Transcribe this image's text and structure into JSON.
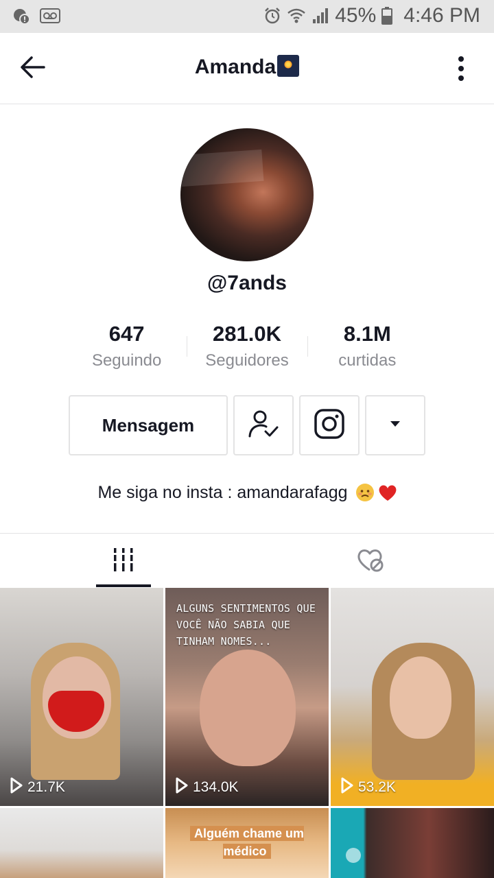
{
  "status_bar": {
    "battery": "45%",
    "time": "4:46 PM",
    "icons": [
      "notification-icon",
      "voicemail-icon",
      "alarm-icon",
      "wifi-icon",
      "signal-icon",
      "battery-icon"
    ]
  },
  "header": {
    "title": "Amanda",
    "title_emoji": "night-sky-emoji",
    "back_icon": "back-arrow-icon",
    "more_icon": "more-vertical-icon"
  },
  "profile": {
    "handle": "@7ands",
    "stats": [
      {
        "value": "647",
        "label": "Seguindo"
      },
      {
        "value": "281.0K",
        "label": "Seguidores"
      },
      {
        "value": "8.1M",
        "label": "curtidas"
      }
    ],
    "actions": {
      "message_label": "Mensagem",
      "follow_icon": "user-check-icon",
      "instagram_icon": "instagram-icon",
      "dropdown_icon": "caret-down-icon"
    },
    "bio": "Me siga no insta : amandarafagg",
    "bio_emojis": [
      "worried-face-emoji",
      "red-heart-emoji"
    ]
  },
  "tabs": [
    {
      "name": "videos",
      "icon": "grid-bars-icon",
      "active": true
    },
    {
      "name": "liked",
      "icon": "hidden-heart-icon",
      "active": false
    }
  ],
  "videos": [
    {
      "views": "21.7K",
      "overlay": ""
    },
    {
      "views": "134.0K",
      "overlay": "ALGUNS SENTIMENTOS QUE VOCÊ NÃO SABIA QUE TINHAM NOMES..."
    },
    {
      "views": "53.2K",
      "overlay": ""
    },
    {
      "views": "",
      "overlay": ""
    },
    {
      "views": "",
      "overlay": "Alguém chame um médico"
    },
    {
      "views": "",
      "overlay": ""
    }
  ],
  "colors": {
    "text": "#161823",
    "muted": "#8a8b91",
    "border": "#e3e3e4",
    "heart": "#e02424"
  }
}
